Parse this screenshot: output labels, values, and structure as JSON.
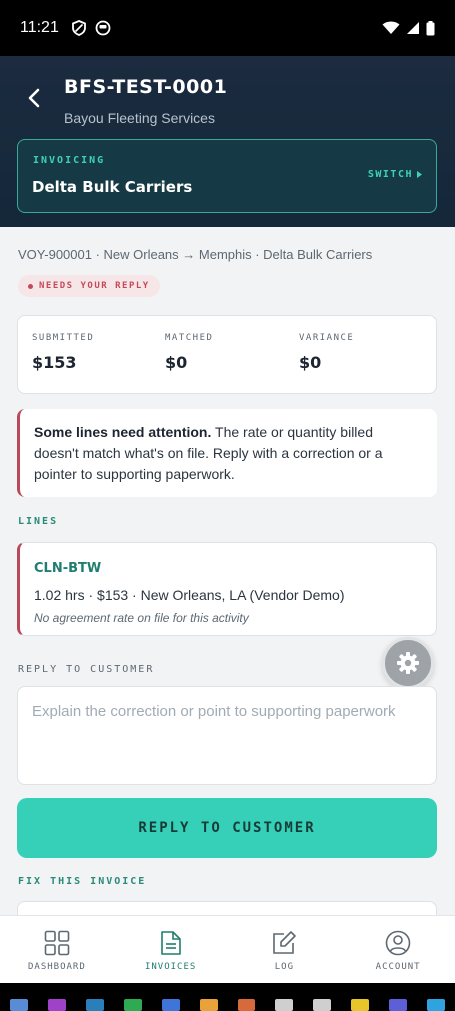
{
  "status_bar": {
    "time": "11:21"
  },
  "header": {
    "title": "BFS-TEST-0001",
    "subtitle": "Bayou Fleeting Services",
    "invoicing": {
      "label": "INVOICING",
      "customer": "Delta Bulk Carriers",
      "switch_label": "SWITCH"
    }
  },
  "voyage": {
    "summary": "VOY-900001 · New Orleans → Memphis · Delta Bulk Carriers",
    "status_badge": "NEEDS YOUR REPLY"
  },
  "stats": [
    {
      "label": "SUBMITTED",
      "value": "$153"
    },
    {
      "label": "MATCHED",
      "value": "$0"
    },
    {
      "label": "VARIANCE",
      "value": "$0"
    }
  ],
  "attention": {
    "heading": "Some lines need attention.",
    "body": " The rate or quantity billed doesn't match what's on file. Reply with a correction or a pointer to supporting paperwork."
  },
  "lines": {
    "section_label": "LINES",
    "items": [
      {
        "code": "CLN-BTW",
        "detail": "1.02 hrs · $153 · New Orleans, LA (Vendor Demo)",
        "note": "No agreement rate on file for this activity"
      }
    ]
  },
  "reply": {
    "section_label": "REPLY TO CUSTOMER",
    "placeholder": "Explain the correction or point to supporting paperwork",
    "button_label": "REPLY TO CUSTOMER"
  },
  "fix": {
    "section_label": "FIX THIS INVOICE"
  },
  "bottom_nav": [
    {
      "label": "DASHBOARD",
      "icon": "grid-icon",
      "active": false
    },
    {
      "label": "INVOICES",
      "icon": "document-icon",
      "active": true
    },
    {
      "label": "LOG",
      "icon": "edit-icon",
      "active": false
    },
    {
      "label": "ACCOUNT",
      "icon": "person-icon",
      "active": false
    }
  ],
  "colors": {
    "header_bg": "#1c2b3f",
    "accent_teal": "#35d0b7",
    "alert_red": "#b8485a"
  }
}
